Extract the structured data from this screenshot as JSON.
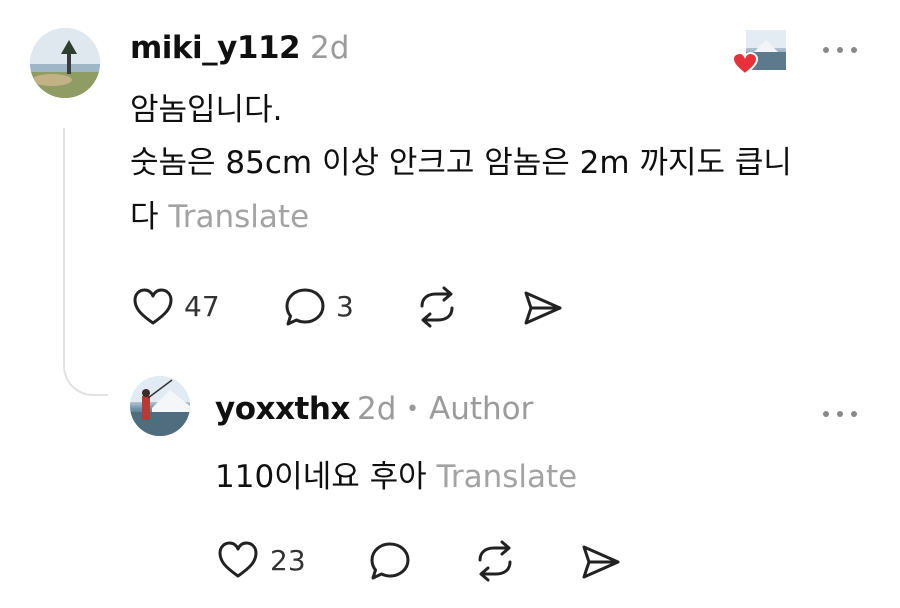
{
  "comments": [
    {
      "username": "miki_y112",
      "time": "2d",
      "more": "…",
      "body_lines": [
        "암놈입니다.",
        "숫놈은 85cm 이상 안크고 암놈은 2m 까지도 큽니",
        "다"
      ],
      "translate": "Translate",
      "likes": "47",
      "replies": "3",
      "icons": [
        "heart-icon",
        "comment-icon",
        "repost-icon",
        "share-icon"
      ]
    },
    {
      "username": "yoxxthx",
      "time": "2d",
      "separator": "•",
      "badge": "Author",
      "more": "…",
      "body": "110이네요 후아",
      "translate": "Translate",
      "likes": "23",
      "icons": [
        "heart-icon",
        "comment-icon",
        "repost-icon",
        "share-icon"
      ]
    }
  ],
  "colors": {
    "like_heart": "#e8303a",
    "muted_text": "#9b9b9b",
    "icon": "#222222",
    "thread_line": "#e2e2e2"
  }
}
